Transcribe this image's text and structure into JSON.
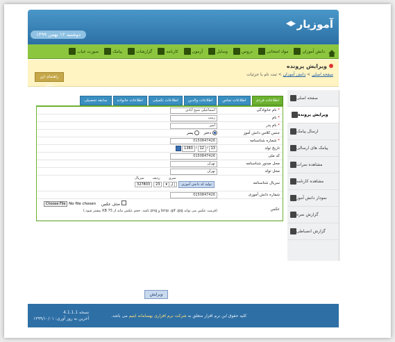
{
  "app": {
    "title": "آموزیار",
    "date": "دوشنبه ۱۲ بهمن ۱۳۹۹"
  },
  "menu": [
    {
      "label": "دانش آموزان"
    },
    {
      "label": "مواد امتحانی"
    },
    {
      "label": "دروس"
    },
    {
      "label": "وسایل"
    },
    {
      "label": "آزمون"
    },
    {
      "label": "کارنامه"
    },
    {
      "label": "گزارشات"
    },
    {
      "label": "پیامک"
    },
    {
      "label": "صورت غیاب"
    }
  ],
  "banner": {
    "title": "ویرایش پرونده",
    "breadcrumb": {
      "home": "صفحه اصلی",
      "students": "دانش آموزان",
      "current": "ثبت نام یا جزئیات"
    },
    "help": "راهنمای این بخش"
  },
  "sidebar": [
    {
      "label": "صفحه اصلی",
      "active": false
    },
    {
      "label": "ویرایش پرونده",
      "active": true
    },
    {
      "label": "ارسال پیامک",
      "active": false
    },
    {
      "label": "پیامک های ارسالی",
      "active": false
    },
    {
      "label": "مشاهده نمرات",
      "active": false
    },
    {
      "label": "مشاهده کارنامه",
      "active": false
    },
    {
      "label": "نمودار دانش آموز",
      "active": false
    },
    {
      "label": "گزارش نمره",
      "active": false
    },
    {
      "label": "گزارش انضباطی",
      "active": false
    }
  ],
  "tabs": [
    {
      "label": "اطلاعات فردی",
      "active": true
    },
    {
      "label": "اطلاعات تماس",
      "active": false
    },
    {
      "label": "اطلاعات والدین",
      "active": false
    },
    {
      "label": "اطلاعات تکمیلی",
      "active": false
    },
    {
      "label": "اطلاعات خانواده",
      "active": false
    },
    {
      "label": "سابقه تحصیلی",
      "active": false
    }
  ],
  "form": {
    "family_label": "نام خانوادگی",
    "family_value": "اسماعیلی شیخ آبادی",
    "name_label": "نام",
    "name_value": "زینب",
    "father_label": "نام پدر",
    "father_value": "امیر",
    "gender_label": "جنس کلاس دانش آموز",
    "gender_male": "پسر",
    "gender_female": "دختر",
    "nid_label": "شماره شناسنامه",
    "nid_value": "0150847426",
    "birth_label": "تاریخ تولد",
    "birth_day": "13",
    "birth_month": "12",
    "birth_year": "1383",
    "national_label": "کد ملی",
    "national_value": "0150847426",
    "issue_label": "محل صدور شناسنامه",
    "issue_value": "تهران",
    "birthplace_label": "محل تولد",
    "birthplace_value": "تهران",
    "serial_label": "سریال شناسنامه",
    "serial_h1": "سریال",
    "serial_h2": "ردیف",
    "serial_h3": "سری",
    "serial_v1": "327803",
    "serial_v2": "23",
    "serial_v3": "ل",
    "serial_btn": "تولید کد دانش آموزی",
    "student_code_label": "شماره دانش آموزی",
    "student_code_value": "0150847426",
    "photo_label": "عکس",
    "photo_file_btn": "Choose File",
    "photo_file_status": "No file chosen",
    "photo_delete": "حذف عکس",
    "photo_note": "(فرمت عکس می تواند bmp ،gif ،jpg و png باشد. حجم عکس نباید از 75 KB بیشتر شود.)",
    "submit": "ویرایش"
  },
  "footer": {
    "copy": "کلیه حقوق این نرم افزار متعلق به",
    "company": "شرکت نرم افزاری بهسامانه ابتیم",
    "copy_end": "می باشد.",
    "version": "نسخه 4.1.1.1",
    "update": "آخرین به روز آوری: ۱۳۹۹/۱۰/۰۱"
  }
}
